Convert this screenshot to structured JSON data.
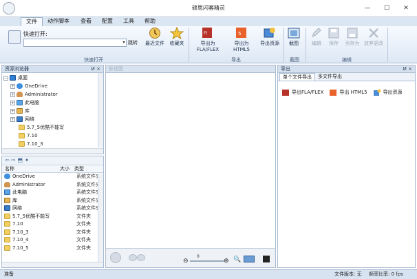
{
  "app": {
    "title": "硕思闪客精灵"
  },
  "window_controls": {
    "minimize": "—",
    "maximize": "☐",
    "close": "✕"
  },
  "menu": [
    "文件",
    "动作脚本",
    "查看",
    "配置",
    "工具",
    "帮助"
  ],
  "ribbon": {
    "quick_open": {
      "label": "快速打开:",
      "input_value": "",
      "go": "跳转",
      "recent": "最近文件",
      "favorites": "收藏夹",
      "group": "快速打开"
    },
    "export": {
      "fla": "导出为FLA/FLEX",
      "html5": "导出为HTML5",
      "resources": "导出资源",
      "group": "导出"
    },
    "screenshot": {
      "label": "截图",
      "group": "截图"
    },
    "edit": {
      "edit": "编辑",
      "save": "保存",
      "save_as": "另存为",
      "discard": "放弃更改",
      "group": "编辑"
    }
  },
  "explorer": {
    "title": "资源浏览器",
    "pin": "И ×",
    "tree": [
      {
        "label": "桌面",
        "icon": "desktop-icon",
        "level": 0,
        "expander": "−"
      },
      {
        "label": "OneDrive",
        "icon": "cloud-icon",
        "level": 1,
        "expander": "+"
      },
      {
        "label": "Administrator",
        "icon": "user-icon",
        "level": 1,
        "expander": "+"
      },
      {
        "label": "此电脑",
        "icon": "pc-icon",
        "level": 1,
        "expander": "+"
      },
      {
        "label": "库",
        "icon": "library-icon",
        "level": 1,
        "expander": "+"
      },
      {
        "label": "网络",
        "icon": "network-icon",
        "level": 1,
        "expander": "+"
      },
      {
        "label": "5.7_5优酷不能写",
        "icon": "folder-icon",
        "level": 2,
        "expander": ""
      },
      {
        "label": "7.10",
        "icon": "folder-icon",
        "level": 2,
        "expander": ""
      },
      {
        "label": "7.10_3",
        "icon": "folder-icon",
        "level": 2,
        "expander": ""
      }
    ],
    "columns": {
      "name": "名称",
      "size": "大小",
      "type": "类型"
    },
    "files": [
      {
        "name": "OneDrive",
        "type": "系统文件夹",
        "icon": "cloud-icon"
      },
      {
        "name": "Administrator",
        "type": "系统文件夹",
        "icon": "user-icon"
      },
      {
        "name": "此电脑",
        "type": "系统文件夹",
        "icon": "pc-icon"
      },
      {
        "name": "库",
        "type": "系统文件夹",
        "icon": "library-icon"
      },
      {
        "name": "网络",
        "type": "系统文件夹",
        "icon": "network-icon"
      },
      {
        "name": "5.7_5优酷不能写",
        "type": "文件夹",
        "icon": "folder-icon"
      },
      {
        "name": "7.10",
        "type": "文件夹",
        "icon": "folder-icon"
      },
      {
        "name": "7.10_3",
        "type": "文件夹",
        "icon": "folder-icon"
      },
      {
        "name": "7.10_4",
        "type": "文件夹",
        "icon": "folder-icon"
      },
      {
        "name": "7.10_5",
        "type": "文件夹",
        "icon": "folder-icon"
      }
    ]
  },
  "preview": {
    "title": "影视图",
    "timeline": {
      "value": "0"
    }
  },
  "export_panel": {
    "title": "导出",
    "tabs": [
      "单个文件导出",
      "多文件导出"
    ],
    "buttons": [
      "导出FLA/FLEX",
      "导出 HTML5",
      "导出资源"
    ]
  },
  "status": {
    "left": "准备",
    "version": "文件版本: 无",
    "fps": "频率比率: 0 fps"
  },
  "colors": {
    "ribbon": "#dde8f5",
    "panel_header": "#d4e0ee",
    "accent": "#2f7fd6"
  }
}
